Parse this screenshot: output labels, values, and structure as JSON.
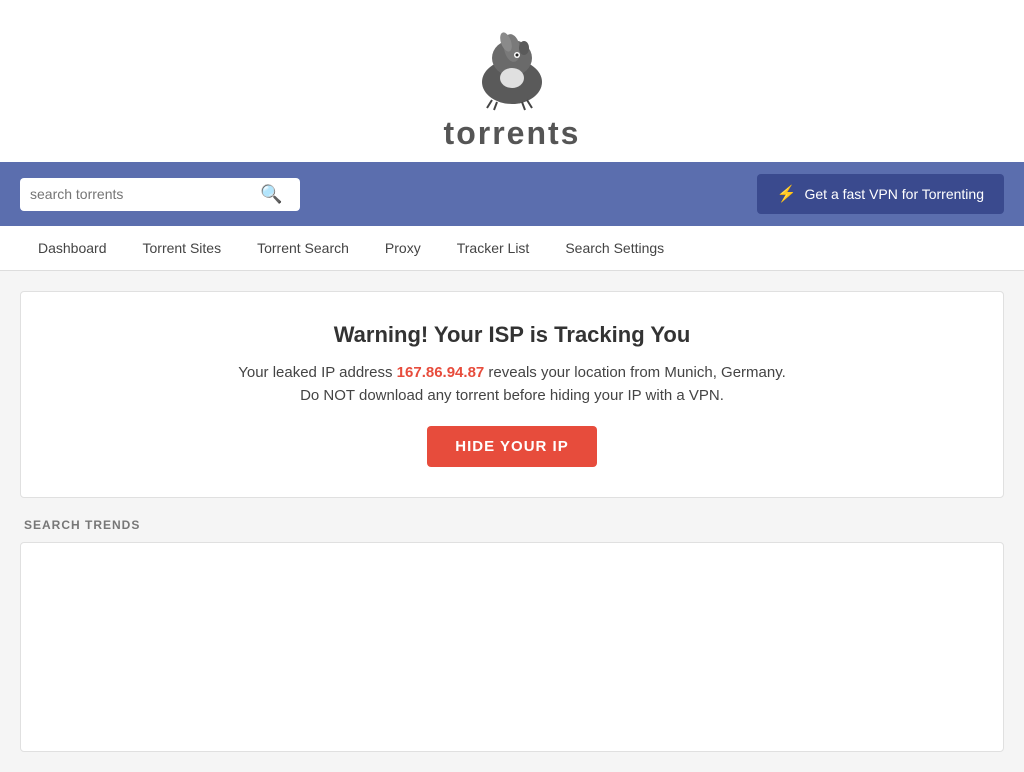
{
  "header": {
    "logo_text": "torrents",
    "logo_alt": "Torrents logo anteater"
  },
  "search": {
    "placeholder": "search torrents",
    "input_value": ""
  },
  "vpn_button": {
    "label": "Get a fast VPN for Torrenting",
    "icon": "⚡"
  },
  "nav": {
    "items": [
      {
        "label": "Dashboard",
        "id": "dashboard"
      },
      {
        "label": "Torrent Sites",
        "id": "torrent-sites"
      },
      {
        "label": "Torrent Search",
        "id": "torrent-search"
      },
      {
        "label": "Proxy",
        "id": "proxy"
      },
      {
        "label": "Tracker List",
        "id": "tracker-list"
      },
      {
        "label": "Search Settings",
        "id": "search-settings"
      }
    ]
  },
  "warning": {
    "title": "Warning! Your ISP is Tracking You",
    "text1_prefix": "Your leaked IP address ",
    "ip_address": "167.86.94.87",
    "text1_suffix": " reveals your location from Munich, Germany.",
    "text2": "Do NOT download any torrent before hiding your IP with a VPN.",
    "hide_ip_label": "HIDE YOUR IP"
  },
  "search_trends": {
    "label": "SEARCH TRENDS"
  }
}
